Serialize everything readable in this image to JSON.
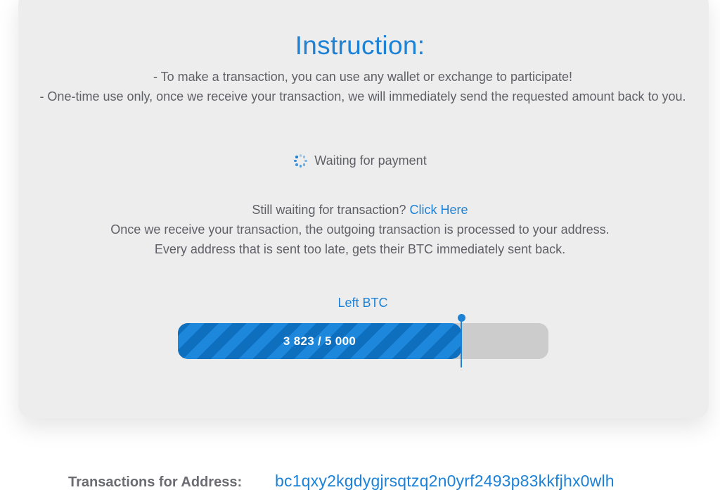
{
  "instruction": {
    "title": "Instruction:",
    "line1": "- To make a transaction, you can use any wallet or exchange to participate!",
    "line2": "- One-time use only, once we receive your transaction, we will immediately send the requested amount back to you."
  },
  "status": {
    "icon": "loading-spinner-icon",
    "text": "Waiting for payment"
  },
  "info": {
    "prompt": "Still waiting for transaction?",
    "link_label": "Click Here",
    "line2": "Once we receive your transaction, the outgoing transaction is processed to your address.",
    "line3": "Every address that is sent too late, gets their BTC immediately sent back."
  },
  "progress": {
    "label": "Left BTC",
    "text": "3 823 / 5 000",
    "current": 3823,
    "total": 5000
  },
  "address": {
    "label": "Transactions for Address:",
    "value": "bc1qxy2kgdygjrsqtzq2n0yrf2493p83kkfjhx0wlh"
  },
  "colors": {
    "accent": "#1d82d6",
    "card_background": "#ededee",
    "progress_track": "#cccccc",
    "progress_stripe_dark": "#0f6fbf",
    "progress_stripe_light": "#1d87dc",
    "body_text": "#5f5f66"
  }
}
